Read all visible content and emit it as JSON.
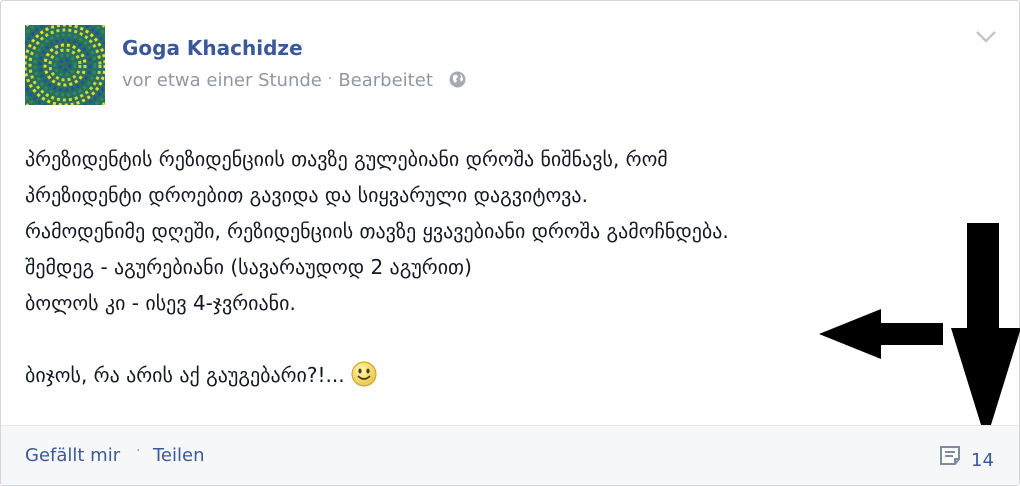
{
  "post": {
    "author": "Goga Khachidze",
    "time": "vor etwa einer Stunde",
    "separator": "·",
    "edited": "Bearbeitet",
    "lines": [
      "პრეზიდენტის რეზიდენციის თავზე გულებიანი დროშა ნიშნავს, რომ",
      "პრეზიდენტი დროებით გავიდა და სიყვარული დაგვიტოვა.",
      "რამოდენიმე დღეში, რეზიდენციის თავზე ყვავებიანი დროშა გამოჩნდება.",
      "შემდეგ - აგურებიანი (სავარაუდოდ 2 აგურით)",
      "ბოლოს კი - ისევ 4-ჯვრიანი.",
      "",
      "ბიჯოს, რა არის აქ გაუგებარი?!..."
    ]
  },
  "actions": {
    "like": "Gefällt mir",
    "separator": "·",
    "share": "Teilen",
    "comment_count": "14"
  },
  "icons": {
    "avatar": "optical-illusion-avatar",
    "privacy": "globe-icon",
    "menu": "chevron-down-icon",
    "comment": "comment-icon",
    "emoticon": "smiley-icon"
  },
  "colors": {
    "link": "#3b5998",
    "meta": "#9197a3",
    "text": "#141823",
    "footer_bg": "#f6f7f9"
  }
}
